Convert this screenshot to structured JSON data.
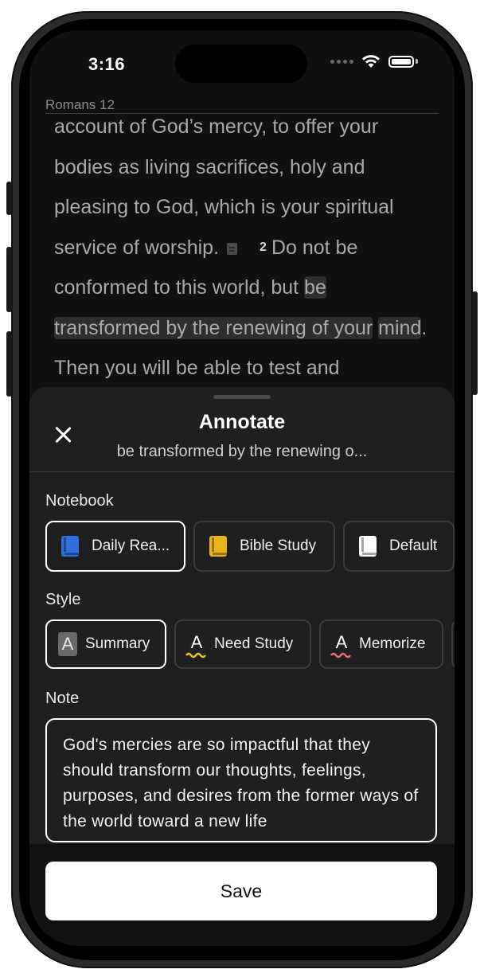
{
  "status_bar": {
    "time": "3:16"
  },
  "reader": {
    "chapter": "Romans 12",
    "text_before_note": "account of God’s mercy, to offer your bodies as living sacrifices, holy and pleasing to God, which is your spiritual service of worship.",
    "verse_number": "2",
    "text_verse_start": "Do not be conformed to this world, but ",
    "highlight_1": "be",
    "highlight_2": "transformed by the renewing of your",
    "highlight_3": "mind",
    "text_after": ". Then you will be able to test and"
  },
  "sheet": {
    "title": "Annotate",
    "subtitle": "be transformed by the renewing o...",
    "notebook_label": "Notebook",
    "notebooks": [
      {
        "label": "Daily Rea...",
        "color": "#2f6fe0",
        "selected": true
      },
      {
        "label": "Bible Study",
        "color": "#e8b417",
        "selected": false
      },
      {
        "label": "Default",
        "color": "#ffffff",
        "selected": false
      }
    ],
    "style_label": "Style",
    "styles": [
      {
        "label": "Summary",
        "selected": true
      },
      {
        "label": "Need Study",
        "underline_color": "#e8c71a",
        "selected": false
      },
      {
        "label": "Memorize",
        "underline_color": "#e86b7a",
        "selected": false
      }
    ],
    "note_label": "Note",
    "note_text": "God's mercies are so impactful that they should transform our thoughts, feelings, purposes, and desires from the former ways of the world toward a new life",
    "save_label": "Save"
  }
}
